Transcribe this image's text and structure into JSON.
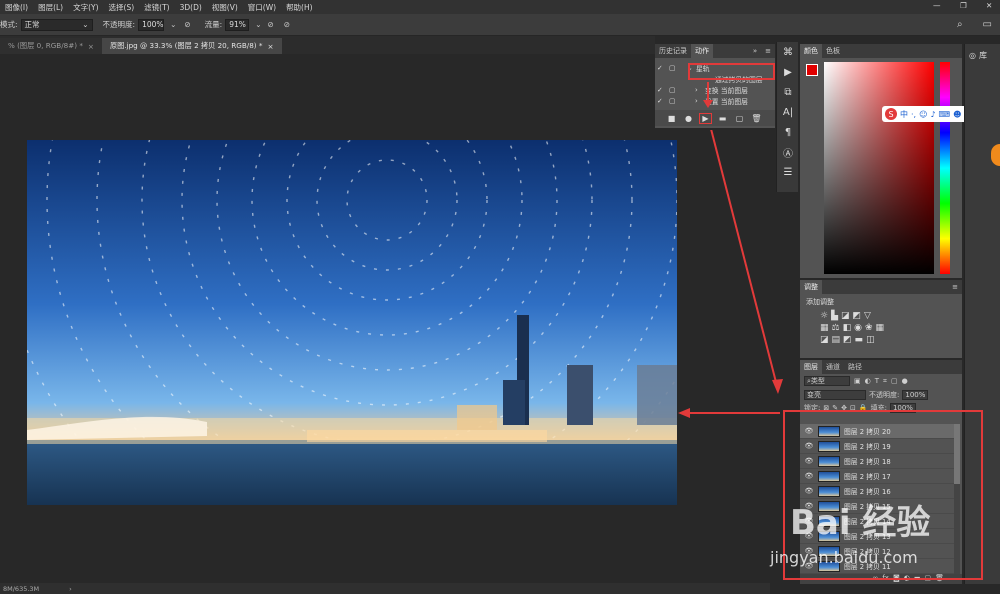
{
  "menu": {
    "items": [
      "图像(I)",
      "图层(L)",
      "文字(Y)",
      "选择(S)",
      "滤镜(T)",
      "3D(D)",
      "视图(V)",
      "窗口(W)",
      "帮助(H)"
    ]
  },
  "window_controls": {
    "minimize": "—",
    "restore": "❐",
    "close": "✕"
  },
  "options_bar": {
    "mode_label": "模式:",
    "mode_value": "正常",
    "opacity_label": "不透明度:",
    "opacity_value": "100%",
    "flow_label": "流量:",
    "flow_value": "91%"
  },
  "doc_tabs": [
    {
      "label": "% (图层 0, RGB/8#) *",
      "close": "×"
    },
    {
      "label": "原图.jpg @ 33.3% (图层 2 拷贝 20, RGB/8) *",
      "close": "×"
    }
  ],
  "status": {
    "size": "8M/635.3M"
  },
  "history_panel": {
    "tab_history": "历史记录",
    "tab_actions": "动作",
    "rows": [
      {
        "check": "✓",
        "label": "星轨"
      },
      {
        "check": "✓",
        "label": "通过拷贝的图层"
      },
      {
        "check": "✓",
        "label": "变换 当前图层"
      },
      {
        "check": "✓",
        "label": "设置 当前图层"
      }
    ]
  },
  "color_panel": {
    "tab_color": "颜色",
    "tab_swatches": "色板"
  },
  "adjust_panel": {
    "title": "调整",
    "add_label": "添加调整"
  },
  "layers_panel": {
    "tab_layers": "图层",
    "tab_channels": "通道",
    "tab_paths": "路径",
    "filter_kind": "类型",
    "blend_mode": "变亮",
    "opacity_label": "不透明度:",
    "opacity_value": "100%",
    "lock_label": "锁定:",
    "fill_label": "填充:",
    "fill_value": "100%",
    "layers": [
      "图层 2 拷贝 20",
      "图层 2 拷贝 19",
      "图层 2 拷贝 18",
      "图层 2 拷贝 17",
      "图层 2 拷贝 16",
      "图层 2 拷贝 15",
      "图层 2 拷贝 14",
      "图层 2 拷贝 13",
      "图层 2 拷贝 12",
      "图层 2 拷贝 11"
    ]
  },
  "libraries": {
    "label": "库"
  },
  "ime": {
    "label": "中"
  },
  "watermark": {
    "brand": "Bai 经验",
    "url": "jingyan.baidu.com"
  },
  "colors": {
    "accent_red": "#e23a3a",
    "fg_swatch": "#e00000"
  }
}
